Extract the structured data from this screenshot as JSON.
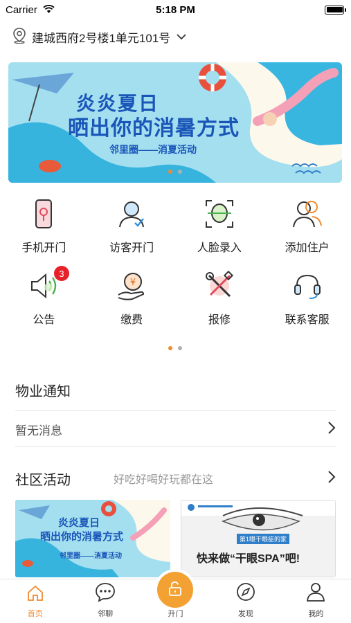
{
  "status_bar": {
    "carrier": "Carrier",
    "time": "5:18 PM"
  },
  "location": {
    "address": "建城西府2号楼1单元101号"
  },
  "banner": {
    "title_line1": "炎炎夏日",
    "title_line2": "晒出你的消暑方式",
    "subtitle": "邻里圈——消夏活动",
    "page_count": 2,
    "active_page": 1
  },
  "grid": {
    "items": [
      {
        "label": "手机开门",
        "icon": "phone-door-icon"
      },
      {
        "label": "访客开门",
        "icon": "visitor-icon"
      },
      {
        "label": "人脸录入",
        "icon": "face-scan-icon"
      },
      {
        "label": "添加住户",
        "icon": "add-resident-icon"
      },
      {
        "label": "公告",
        "icon": "speaker-icon",
        "badge": "3"
      },
      {
        "label": "缴费",
        "icon": "payment-icon"
      },
      {
        "label": "报修",
        "icon": "repair-tools-icon"
      },
      {
        "label": "联系客服",
        "icon": "headset-icon"
      }
    ],
    "page_count": 2,
    "active_page": 1
  },
  "notice": {
    "title": "物业通知",
    "empty_text": "暂无消息"
  },
  "activity": {
    "title": "社区活动",
    "subtitle": "好吃好喝好玩都在这",
    "cards": [
      {
        "line1": "炎炎夏日",
        "line2": "晒出你的消暑方式",
        "line3": "邻里圈——消夏活动"
      },
      {
        "tag": "第1眼干眼症的家",
        "headline": "快来做“干眼SPA”吧!"
      }
    ]
  },
  "tabbar": {
    "tabs": [
      {
        "label": "首页",
        "icon": "home-icon",
        "active": true
      },
      {
        "label": "邻聊",
        "icon": "chat-icon"
      },
      {
        "label": "开门",
        "icon": "unlock-icon"
      },
      {
        "label": "发现",
        "icon": "compass-icon"
      },
      {
        "label": "我的",
        "icon": "profile-icon"
      }
    ]
  },
  "colors": {
    "accent": "#f08a2c",
    "badge": "#e62129",
    "banner_bg": "#9fdcec",
    "title_blue": "#1a56b8"
  }
}
